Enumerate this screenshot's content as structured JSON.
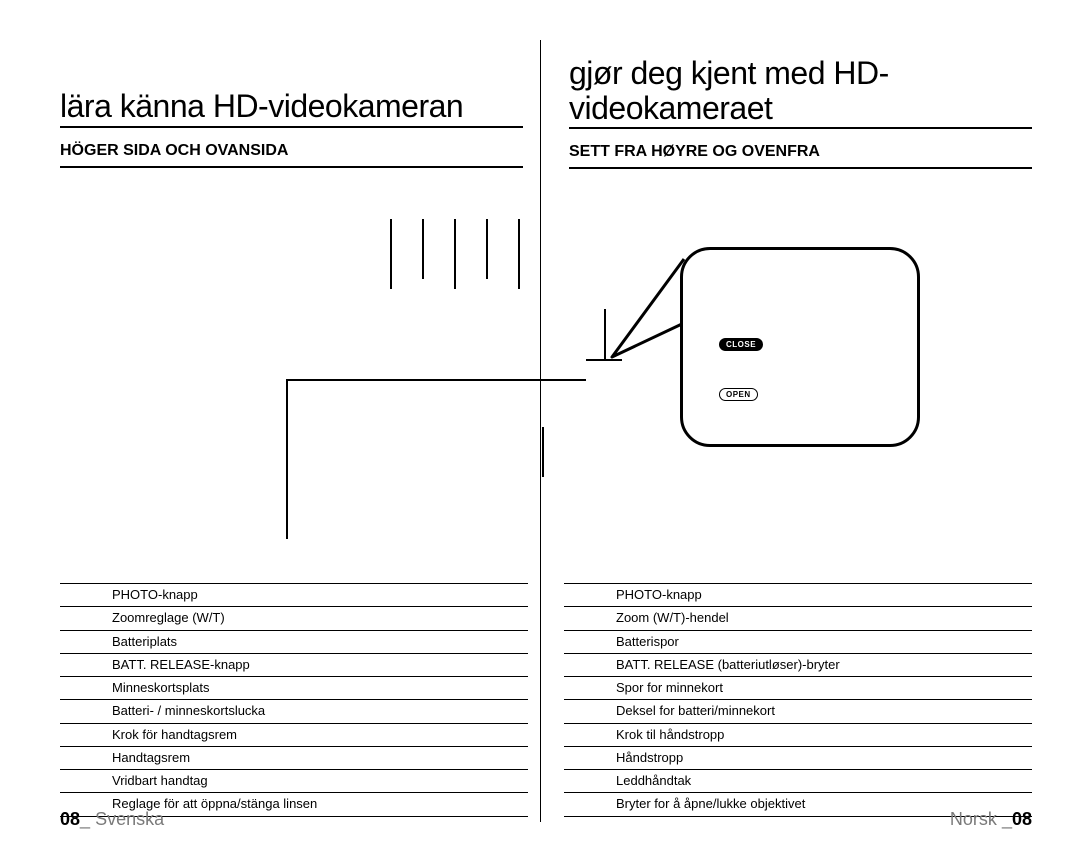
{
  "left": {
    "title": "lära känna HD-videokameran",
    "subhead": "HÖGER SIDA OCH OVANSIDA",
    "items": [
      "PHOTO-knapp",
      "Zoomreglage (W/T)",
      "Batteriplats",
      "BATT. RELEASE-knapp",
      "Minneskortsplats",
      "Batteri- / minneskortslucka",
      "Krok för handtagsrem",
      "Handtagsrem",
      "Vridbart handtag",
      "Reglage för att öppna/stänga linsen"
    ],
    "page_number": "08",
    "page_lang": "Svenska"
  },
  "right": {
    "title": "gjør deg kjent med HD-videokameraet",
    "subhead": "SETT FRA HØYRE OG OVENFRA",
    "items": [
      "PHOTO-knapp",
      "Zoom (W/T)-hendel",
      "Batterispor",
      "BATT. RELEASE (batteriutløser)-bryter",
      "Spor for minnekort",
      "Deksel for batteri/minnekort",
      "Krok til håndstropp",
      "Håndstropp",
      "Leddhåndtak",
      "Bryter for å åpne/lukke objektivet"
    ],
    "page_number": "08",
    "page_lang": "Norsk"
  },
  "bubble": {
    "close_label": "CLOSE",
    "open_label": "OPEN"
  },
  "footer_sep": "_"
}
